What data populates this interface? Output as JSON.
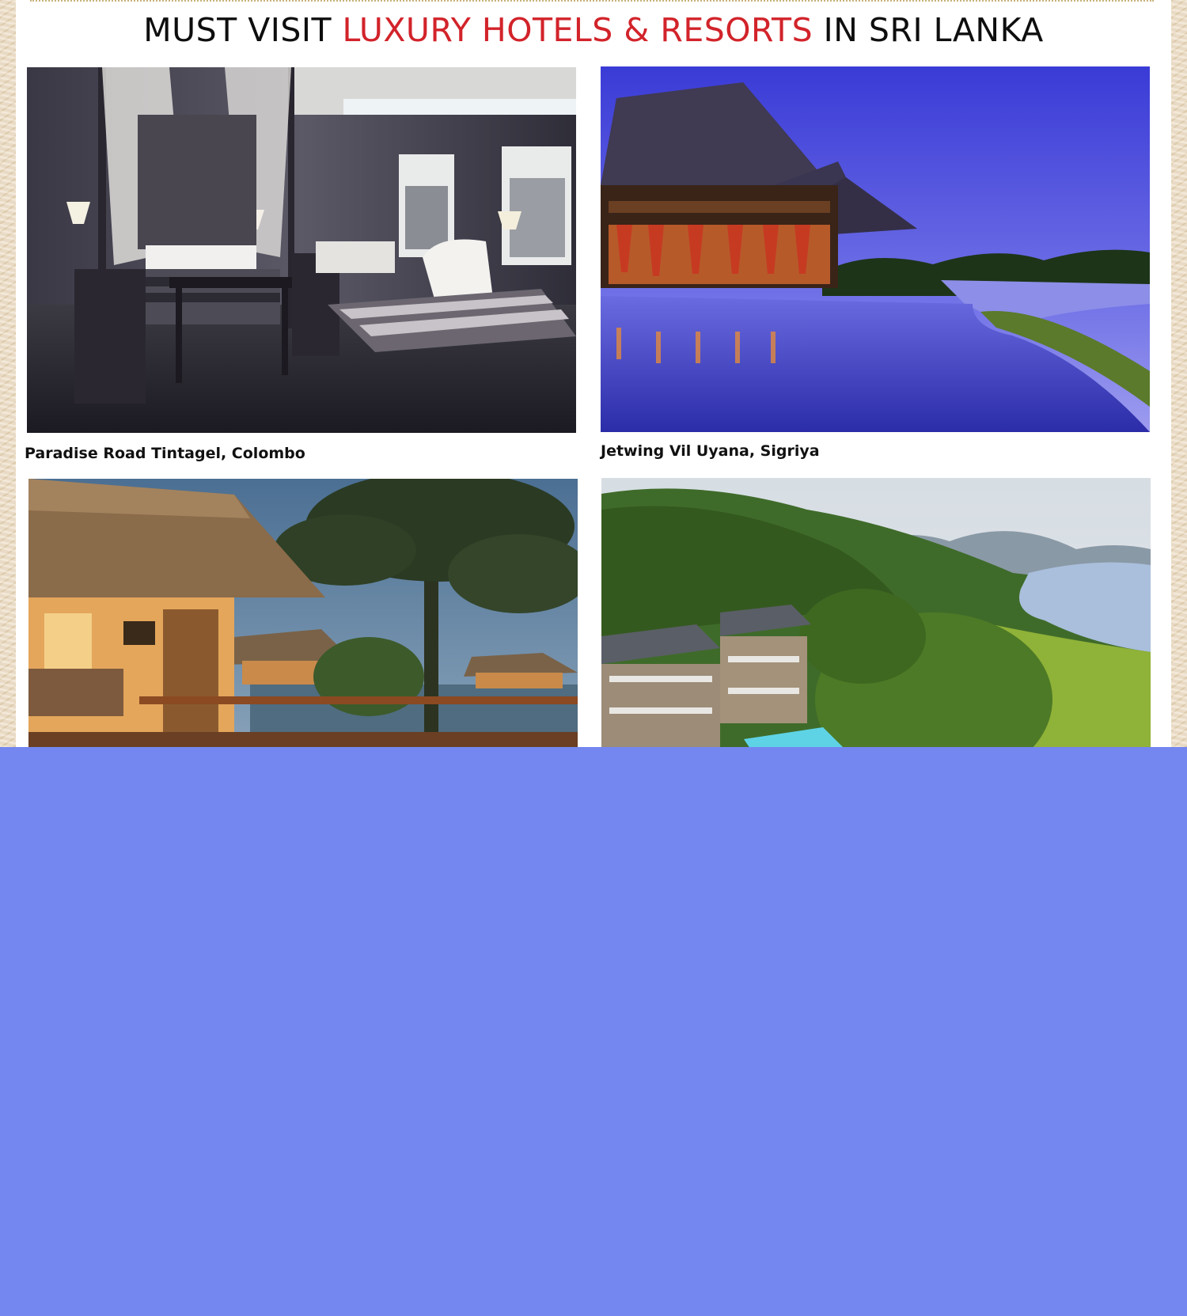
{
  "header": {
    "title_part1": "MUST VISIT ",
    "title_accent": "LUXURY HOTELS & RESORTS",
    "title_part2": " IN SRI LANKA"
  },
  "hotels": [
    {
      "name": "Paradise Road Tintagel, Colombo",
      "image": "hotel-bedroom-photo"
    },
    {
      "name": "Jetwing Vil Uyana, Sigriya",
      "image": "resort-infinity-pool-photo"
    },
    {
      "name": "",
      "image": "thatched-villa-lake-photo"
    },
    {
      "name": "",
      "image": "hillside-resort-river-photo"
    }
  ],
  "colors": {
    "accent": "#d2232a",
    "backdrop": "#7486ef"
  }
}
